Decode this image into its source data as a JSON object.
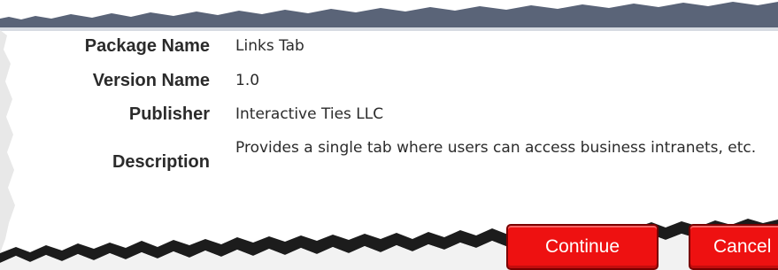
{
  "details": {
    "package_name": {
      "label": "Package Name",
      "value": "Links Tab"
    },
    "version_name": {
      "label": "Version Name",
      "value": "1.0"
    },
    "publisher": {
      "label": "Publisher",
      "value": "Interactive Ties LLC"
    },
    "description": {
      "label": "Description",
      "value": "Provides a single tab where users can access business intranets, etc."
    }
  },
  "buttons": {
    "continue_label": "Continue",
    "cancel_label": "Cancel"
  },
  "colors": {
    "header_bar": "#5a6478",
    "button_red": "#ee1111",
    "text": "#2b2b2b"
  }
}
